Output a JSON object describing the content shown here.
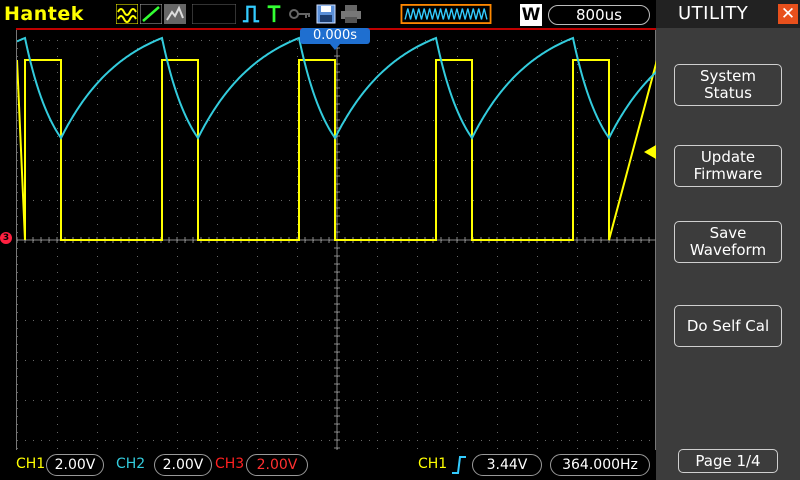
{
  "header": {
    "brand": "Hantek",
    "timebase_mode": "W",
    "timebase": "800us"
  },
  "trigger": {
    "time_offset": "0.000s",
    "channel_marker": "3"
  },
  "bottom": {
    "ch1": {
      "label": "CH1",
      "value": "2.00V",
      "color": "#ffff00"
    },
    "ch2": {
      "label": "CH2",
      "value": "2.00V",
      "color": "#33ccdd"
    },
    "ch3": {
      "label": "CH3",
      "value": "2.00V",
      "color": "#ff2020"
    },
    "trigger_source": "CH1",
    "trigger_level": "3.44V",
    "frequency": "364.000Hz"
  },
  "panel": {
    "title": "UTILITY",
    "buttons": [
      {
        "line1": "System",
        "line2": "Status"
      },
      {
        "line1": "Update",
        "line2": "Firmware"
      },
      {
        "line1": "Save",
        "line2": "Waveform"
      },
      {
        "line1": "Do Self Cal",
        "line2": ""
      }
    ],
    "page": "Page 1/4"
  },
  "colors": {
    "ch1": "#ffff00",
    "ch2": "#33ccdd",
    "grid": "#888888",
    "panel_bg": "#3c3c3c"
  }
}
